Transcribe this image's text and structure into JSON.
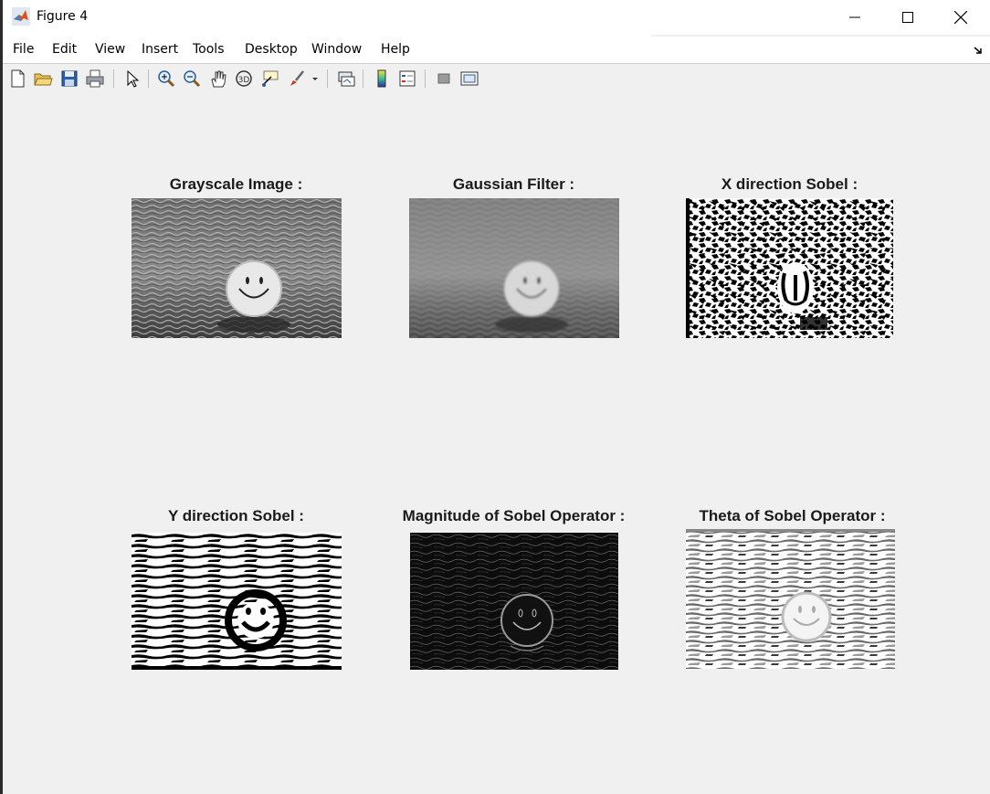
{
  "window": {
    "title": "Figure 4",
    "controls": [
      "minimize",
      "maximize",
      "close"
    ]
  },
  "menu": {
    "items": [
      "File",
      "Edit",
      "View",
      "Insert",
      "Tools",
      "Desktop",
      "Window",
      "Help"
    ]
  },
  "toolbar": {
    "icons": [
      "new-figure-icon",
      "open-file-icon",
      "save-icon",
      "print-icon",
      "edit-plot-icon",
      "zoom-in-icon",
      "zoom-out-icon",
      "pan-icon",
      "rotate-3d-icon",
      "data-cursor-icon",
      "brush-icon",
      "brush-dropdown-icon",
      "link-plot-icon",
      "colorbar-icon",
      "legend-icon",
      "hide-plot-tools-icon",
      "show-plot-tools-icon"
    ]
  },
  "figure": {
    "panels": [
      {
        "title": "Grayscale Image :",
        "kind": "grayscale"
      },
      {
        "title": "Gaussian Filter :",
        "kind": "gaussian"
      },
      {
        "title": "X direction Sobel :",
        "kind": "binary-x"
      },
      {
        "title": "Y direction Sobel :",
        "kind": "binary-y"
      },
      {
        "title": "Magnitude of Sobel Operator :",
        "kind": "magnitude"
      },
      {
        "title": "Theta of Sobel Operator :",
        "kind": "theta"
      }
    ]
  },
  "colors": {
    "figure_bg": "#f0f0f0",
    "title_text": "#1a1a1a",
    "matlab_logo": "#d9531e"
  }
}
